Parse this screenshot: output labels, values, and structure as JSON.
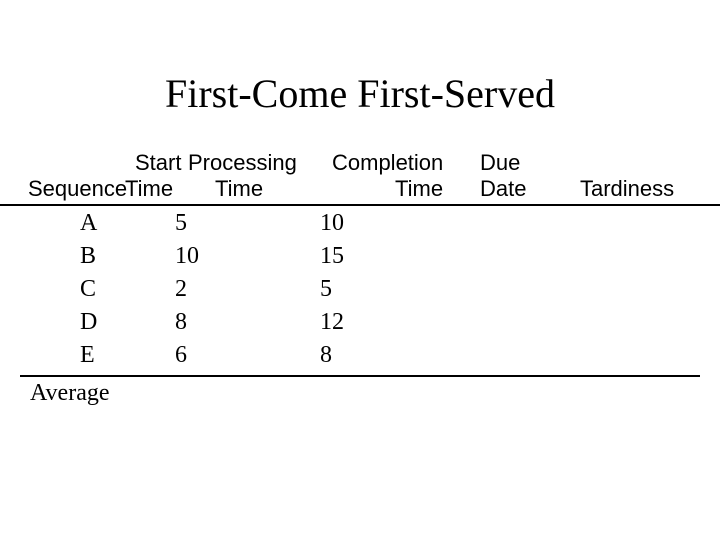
{
  "title": "First-Come First-Served",
  "headers": {
    "sequence": "Sequence",
    "start1": "Start",
    "start2": "Time",
    "proc1": "Processing",
    "proc2": "Time",
    "comp1": "Completion",
    "comp2": "Time",
    "due1": "Due",
    "due2": "Date",
    "tard": "Tardiness"
  },
  "rows": [
    {
      "seq": "A",
      "proc": "5",
      "due": "10"
    },
    {
      "seq": "B",
      "proc": "10",
      "due": "15"
    },
    {
      "seq": "C",
      "proc": "2",
      "due": "5"
    },
    {
      "seq": "D",
      "proc": "8",
      "due": "12"
    },
    {
      "seq": "E",
      "proc": "6",
      "due": "8"
    }
  ],
  "average_label": "Average",
  "chart_data": {
    "type": "table",
    "title": "First-Come First-Served",
    "columns": [
      "Sequence",
      "Start Time",
      "Processing Time",
      "Completion Time",
      "Due Date",
      "Tardiness"
    ],
    "rows": [
      [
        "A",
        null,
        5,
        null,
        10,
        null
      ],
      [
        "B",
        null,
        10,
        null,
        15,
        null
      ],
      [
        "C",
        null,
        2,
        null,
        5,
        null
      ],
      [
        "D",
        null,
        8,
        null,
        12,
        null
      ],
      [
        "E",
        null,
        6,
        null,
        8,
        null
      ]
    ],
    "footer": [
      "Average",
      null,
      null,
      null,
      null,
      null
    ]
  }
}
